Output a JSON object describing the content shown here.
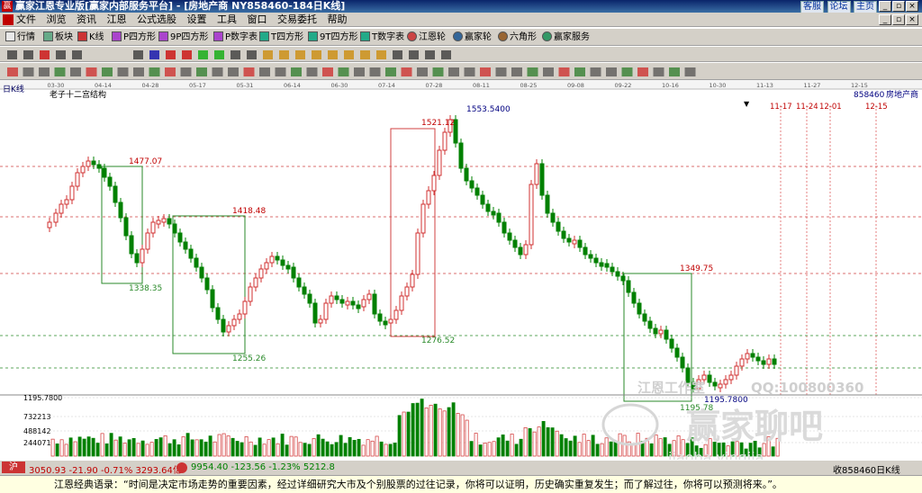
{
  "title_bar": {
    "text": "赢家江恩专业版[赢家内部服务平台] - [房地产商  NY858460-184日K线]",
    "links": [
      "客服",
      "论坛",
      "主页"
    ]
  },
  "menu": [
    "文件",
    "浏览",
    "资讯",
    "江恩",
    "公式选股",
    "设置",
    "工具",
    "窗口",
    "交易委托",
    "帮助"
  ],
  "toolbar1": [
    "行情",
    "板块",
    "K线",
    "P四方形",
    "9P四方形",
    "P数字表",
    "T四方形",
    "9T四方形",
    "T数字表",
    "江恩轮",
    "赢家轮",
    "六角形",
    "赢家服务"
  ],
  "chart": {
    "period_label": "日K线",
    "indicator_label": "老子十二宫结构",
    "code": "858460",
    "name": "房地产商",
    "top_dates": [
      "03-30",
      "04-14",
      "04-28",
      "05-17",
      "05-31",
      "06-14",
      "06-30",
      "07-14",
      "07-28",
      "08-11",
      "08-25",
      "09-08",
      "09-22",
      "10-16",
      "10-30",
      "11-13",
      "11-27",
      "12-15"
    ],
    "future_dates": [
      "11-17",
      "11-24",
      "12-01",
      "12-15"
    ],
    "levels": [
      "1477.07",
      "1338.35",
      "1418.48",
      "1255.26",
      "1521.12",
      "1276.52",
      "1553.5400",
      "1349.75",
      "1195.78",
      "1195.7800"
    ],
    "volume_ticks": [
      "1195.7800",
      "732213",
      "488142",
      "244071"
    ],
    "watermarks": [
      "江恩工作室",
      "QQ:100800360",
      "赢家聊吧",
      "jiaoba.yingjia"
    ]
  },
  "status": {
    "sh": "3050.93 -21.90 -0.71% 3293.64亿",
    "sz": "9954.40 -123.56 -1.23% 5212.8",
    "right": "收858460日K线"
  },
  "quote": "江恩经典语录：“时间是决定市场走势的重要因素，经过详细研究大市及个别股票的过往记录，你将可以证明，历史确实重复发生；而了解过往，你将可以预测将来。”。"
}
